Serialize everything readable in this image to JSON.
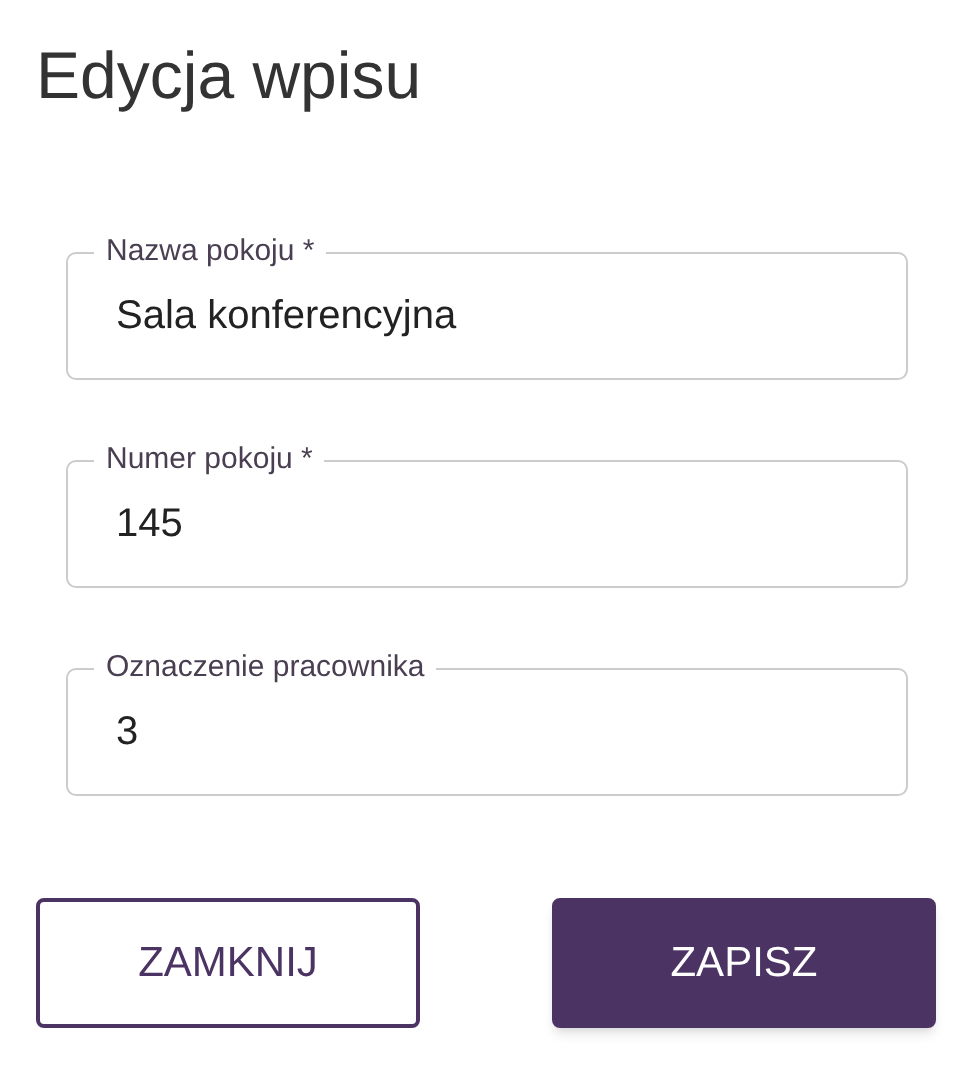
{
  "title": "Edycja wpisu",
  "fields": [
    {
      "label": "Nazwa pokoju *",
      "value": "Sala konferencyjna"
    },
    {
      "label": "Numer pokoju *",
      "value": "145"
    },
    {
      "label": "Oznaczenie pracownika",
      "value": "3"
    }
  ],
  "buttons": [
    {
      "label": "ZAMKNIJ",
      "kind": "outlined"
    },
    {
      "label": "ZAPISZ",
      "kind": "filled"
    }
  ]
}
